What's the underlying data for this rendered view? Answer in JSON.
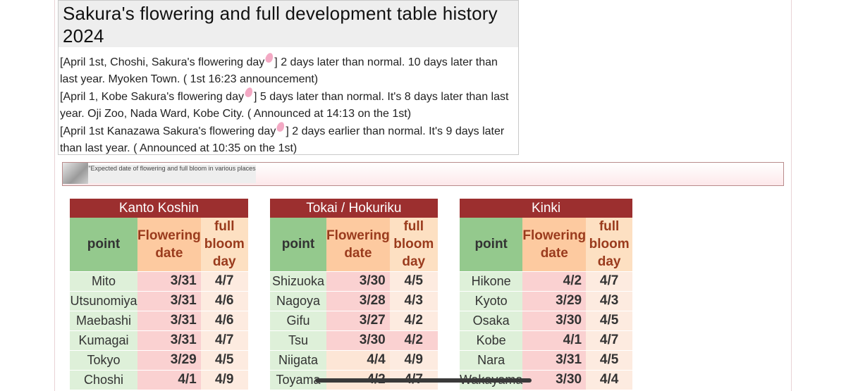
{
  "article": {
    "title": "Sakura's flowering and full development table history 2024",
    "news": [
      {
        "before": "[April 1st, Choshi, Sakura's flowering day",
        "after": "] 2 days later than normal. 10 days later than last year. Myoken Town. ( 1st 16:23 announcement)"
      },
      {
        "before": "[April 1, Kobe Sakura's flowering day",
        "after": "] 5 days later than normal. It's 8 days later than last year. Oji Zoo, Nada Ward, Kobe City. ( Announced at 14:13 on the 1st)"
      },
      {
        "before": "[April 1st Kanazawa Sakura's flowering day",
        "after": "] 2 days earlier than normal. It's 9 days later than last year. ( Announced at 10:35 on the 1st)"
      }
    ]
  },
  "banner": {
    "caption": "\"Expected date of flowering and full bloom in various places"
  },
  "columns": {
    "point": "point",
    "flowering": "Flowering date",
    "bloom": "full bloom day"
  },
  "regions": [
    {
      "name": "Kanto Koshin",
      "rows": [
        {
          "point": "Mito",
          "flowering": "3/31",
          "bloom": "4/7"
        },
        {
          "point": "Utsunomiya",
          "flowering": "3/31",
          "bloom": "4/6"
        },
        {
          "point": "Maebashi",
          "flowering": "3/31",
          "bloom": "4/6"
        },
        {
          "point": "Kumagai",
          "flowering": "3/31",
          "bloom": "4/7"
        },
        {
          "point": "Tokyo",
          "flowering": "3/29",
          "bloom": "4/5"
        },
        {
          "point": "Choshi",
          "flowering": "4/1",
          "bloom": "4/9"
        }
      ]
    },
    {
      "name": "Tokai / Hokuriku",
      "rows": [
        {
          "point": "Shizuoka",
          "flowering": "3/30",
          "bloom": "4/5"
        },
        {
          "point": "Nagoya",
          "flowering": "3/28",
          "bloom": "4/3"
        },
        {
          "point": "Gifu",
          "flowering": "3/27",
          "bloom": "4/2"
        },
        {
          "point": "Tsu",
          "flowering": "3/30",
          "bloom": "4/2"
        },
        {
          "point": "Niigata",
          "flowering": "4/4",
          "bloom": "4/9"
        },
        {
          "point": "Toyama",
          "flowering": "4/2",
          "bloom": "4/7"
        }
      ]
    },
    {
      "name": "Kinki",
      "rows": [
        {
          "point": "Hikone",
          "flowering": "4/2",
          "bloom": "4/7"
        },
        {
          "point": "Kyoto",
          "flowering": "3/29",
          "bloom": "4/3"
        },
        {
          "point": "Osaka",
          "flowering": "3/30",
          "bloom": "4/5"
        },
        {
          "point": "Kobe",
          "flowering": "4/1",
          "bloom": "4/7"
        },
        {
          "point": "Nara",
          "flowering": "3/31",
          "bloom": "4/5"
        },
        {
          "point": "Wakayama",
          "flowering": "3/30",
          "bloom": "4/4"
        }
      ]
    }
  ]
}
